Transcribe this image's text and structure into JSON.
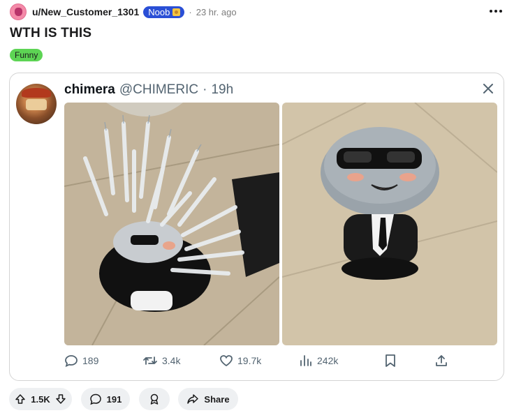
{
  "post": {
    "username": "u/New_Customer_1301",
    "user_flair": "Noob",
    "separator": "·",
    "time_ago": "23 hr. ago",
    "title": "WTH IS THIS",
    "flair": "Funny",
    "flair_color": "#5dd454"
  },
  "tweet": {
    "display_name": "chimera",
    "handle": "@CHIMERIC",
    "separator": "·",
    "time": "19h",
    "images": [
      {
        "icon": "plush-with-syringes-photo"
      },
      {
        "icon": "plush-with-sunglasses-photo"
      }
    ],
    "actions": {
      "replies": "189",
      "retweets": "3.4k",
      "likes": "19.7k",
      "views": "242k"
    }
  },
  "action_bar": {
    "upvotes": "1.5K",
    "comments": "191",
    "share_label": "Share"
  },
  "colors": {
    "user_flair_bg": "#2a4fd6",
    "pill_bg": "#eef0f2",
    "tweet_meta": "#536471"
  }
}
